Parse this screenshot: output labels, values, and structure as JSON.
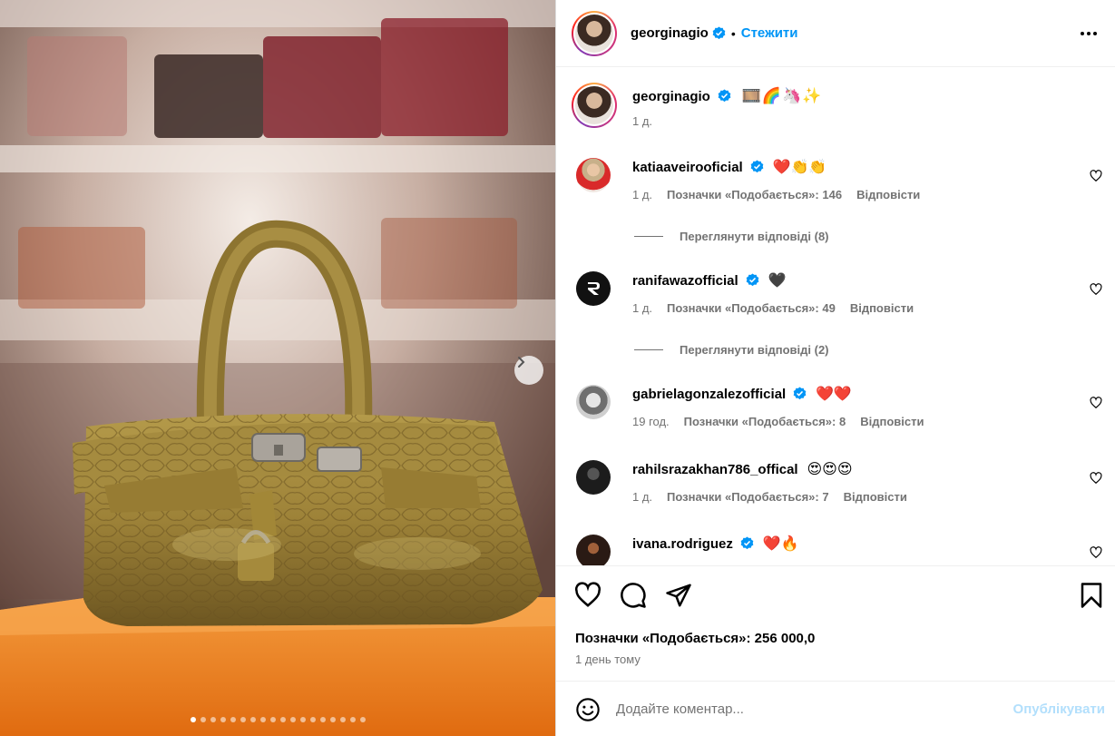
{
  "post": {
    "username": "georginagio",
    "follow_label": "Стежити",
    "separator": "•",
    "caption_emoji": "🎞️🌈🦄✨",
    "caption_time": "1 д.",
    "likes_label": "Позначки «Подобається»: 256 000,0",
    "posted_time": "1 день тому",
    "carousel_count": 18,
    "carousel_active_index": 0
  },
  "comments": [
    {
      "username": "katiaaveirooficial",
      "emoji": "❤️👏👏",
      "time": "1 д.",
      "likes": "Позначки «Подобається»: 146",
      "reply": "Відповісти",
      "view_replies": "Переглянути відповіді (8)"
    },
    {
      "username": "ranifawazofficial",
      "emoji": "🖤",
      "time": "1 д.",
      "likes": "Позначки «Подобається»: 49",
      "reply": "Відповісти",
      "view_replies": "Переглянути відповіді (2)"
    },
    {
      "username": "gabrielagonzalezofficial",
      "emoji": "❤️❤️",
      "time": "19 год.",
      "likes": "Позначки «Подобається»: 8",
      "reply": "Відповісти"
    },
    {
      "username": "rahilsrazakhan786_offical",
      "emoji": "😍😍😍",
      "time": "1 д.",
      "likes": "Позначки «Подобається»: 7",
      "reply": "Відповісти"
    },
    {
      "username": "ivana.rodriguez",
      "emoji": "❤️🔥"
    }
  ],
  "composer": {
    "placeholder": "Додайте коментар...",
    "post_label": "Опублікувати"
  },
  "colors": {
    "accent": "#0095f6",
    "post_disabled": "#b2dffc",
    "muted": "#737373",
    "verified": "#0095f6"
  },
  "icons": [
    "verified-badge-icon",
    "more-options-icon",
    "heart-icon",
    "comment-icon",
    "share-icon",
    "bookmark-icon",
    "emoji-icon",
    "chevron-right-icon"
  ]
}
